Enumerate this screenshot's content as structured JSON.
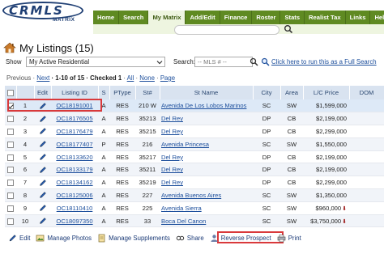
{
  "logo": {
    "text": "CRMLS",
    "sub": "MATRIX"
  },
  "nav": [
    "Home",
    "Search",
    "My Matrix",
    "Add/Edit",
    "Finance",
    "Roster",
    "Stats",
    "Realist Tax",
    "Links",
    "Help"
  ],
  "nav_active": "My Matrix",
  "page_title": "My Listings (15)",
  "show": {
    "label": "Show",
    "selected": "My Active Residential"
  },
  "search": {
    "label": "Search:",
    "placeholder": "-- MLS # --"
  },
  "full_search_link": "Click here to run this as a Full Search",
  "paging": {
    "previous": "Previous",
    "sep1": " · ",
    "next": "Next",
    "range": " · 1-10 of 15",
    "checked": " · Checked 1",
    "sep2": " · ",
    "all": "All",
    "none": "None",
    "page": "Page"
  },
  "table": {
    "headers": [
      "",
      "",
      "Edit",
      "Listing ID",
      "S",
      "PType",
      "St#",
      "St Name",
      "City",
      "Area",
      "L/C Price",
      "DOM"
    ],
    "rows": [
      {
        "n": "1",
        "id": "OC18191001",
        "s": "A",
        "ptype": "RES",
        "stnum": "210 W",
        "stname": "Avenida De Los Lobos Marinos",
        "city": "SC",
        "area": "SW",
        "price": "$1,599,000",
        "dom": "",
        "checked": true,
        "arrow": false
      },
      {
        "n": "2",
        "id": "OC18176505",
        "s": "A",
        "ptype": "RES",
        "stnum": "35213",
        "stname": "Del Rey",
        "city": "DP",
        "area": "CB",
        "price": "$2,199,000",
        "dom": "",
        "checked": false,
        "arrow": false
      },
      {
        "n": "3",
        "id": "OC18176479",
        "s": "A",
        "ptype": "RES",
        "stnum": "35215",
        "stname": "Del Rey",
        "city": "DP",
        "area": "CB",
        "price": "$2,299,000",
        "dom": "",
        "checked": false,
        "arrow": false
      },
      {
        "n": "4",
        "id": "OC18177407",
        "s": "P",
        "ptype": "RES",
        "stnum": "216",
        "stname": "Avenida Princesa",
        "city": "SC",
        "area": "SW",
        "price": "$1,550,000",
        "dom": "",
        "checked": false,
        "arrow": false
      },
      {
        "n": "5",
        "id": "OC18133620",
        "s": "A",
        "ptype": "RES",
        "stnum": "35217",
        "stname": "Del Rey",
        "city": "DP",
        "area": "CB",
        "price": "$2,199,000",
        "dom": "",
        "checked": false,
        "arrow": false
      },
      {
        "n": "6",
        "id": "OC18133179",
        "s": "A",
        "ptype": "RES",
        "stnum": "35211",
        "stname": "Del Rey",
        "city": "DP",
        "area": "CB",
        "price": "$2,199,000",
        "dom": "",
        "checked": false,
        "arrow": false
      },
      {
        "n": "7",
        "id": "OC18134162",
        "s": "A",
        "ptype": "RES",
        "stnum": "35219",
        "stname": "Del Rey",
        "city": "DP",
        "area": "CB",
        "price": "$2,299,000",
        "dom": "",
        "checked": false,
        "arrow": false
      },
      {
        "n": "8",
        "id": "OC18125006",
        "s": "A",
        "ptype": "RES",
        "stnum": "227",
        "stname": "Avenida Buenos Aires",
        "city": "SC",
        "area": "SW",
        "price": "$1,350,000",
        "dom": "",
        "checked": false,
        "arrow": false
      },
      {
        "n": "9",
        "id": "OC18110410",
        "s": "A",
        "ptype": "RES",
        "stnum": "225",
        "stname": "Avenida Sierra",
        "city": "SC",
        "area": "SW",
        "price": "$960,000",
        "dom": "",
        "checked": false,
        "arrow": true
      },
      {
        "n": "10",
        "id": "OC18097350",
        "s": "A",
        "ptype": "RES",
        "stnum": "33",
        "stname": "Boca Del Canon",
        "city": "SC",
        "area": "SW",
        "price": "$3,750,000",
        "dom": "",
        "checked": false,
        "arrow": true
      }
    ]
  },
  "toolbar": {
    "edit": "Edit",
    "manage_photos": "Manage Photos",
    "manage_supplements": "Manage Supplements",
    "share": "Share",
    "reverse_prospect": "Reverse Prospect",
    "print": "Print"
  },
  "colors": {
    "nav_green": "#5f8a22",
    "header_blue": "#d9e3f0",
    "link_blue": "#1d4f9c",
    "highlight_red": "#d9393b"
  }
}
